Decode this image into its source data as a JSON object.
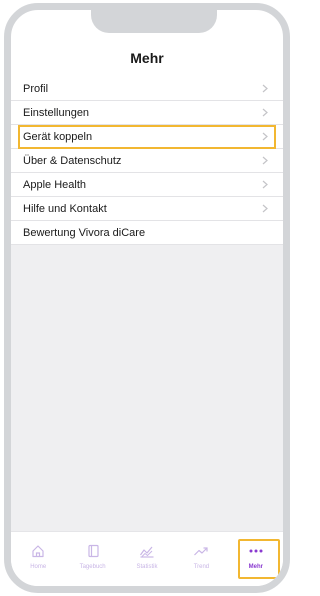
{
  "header": {
    "title": "Mehr"
  },
  "menu": {
    "items": [
      {
        "label": "Profil",
        "chevron": true
      },
      {
        "label": "Einstellungen",
        "chevron": true
      },
      {
        "label": "Gerät koppeln",
        "chevron": true,
        "highlighted": true
      },
      {
        "label": "Über & Datenschutz",
        "chevron": true
      },
      {
        "label": "Apple Health",
        "chevron": true
      },
      {
        "label": "Hilfe und Kontakt",
        "chevron": true
      },
      {
        "label": "Bewertung Vivora diCare",
        "chevron": false
      }
    ]
  },
  "tabbar": {
    "tabs": [
      {
        "label": "Home",
        "icon": "home-icon"
      },
      {
        "label": "Tagebuch",
        "icon": "book-icon"
      },
      {
        "label": "Statistik",
        "icon": "statistics-icon"
      },
      {
        "label": "Trend",
        "icon": "trend-icon"
      },
      {
        "label": "Mehr",
        "icon": "more-dots-icon",
        "active": true
      }
    ]
  },
  "colors": {
    "accent": "#8a3ad0",
    "accent_inactive": "#c9b6e6",
    "highlight": "#f2b731",
    "background": "#efeff1",
    "frame": "#d3d5d8"
  }
}
